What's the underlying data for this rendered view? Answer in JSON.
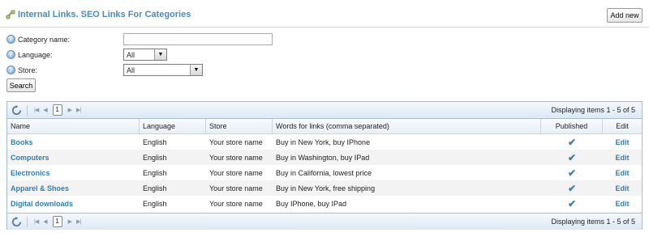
{
  "header": {
    "title": "Internal Links. SEO Links For Categories",
    "add_label": "Add new"
  },
  "filters": {
    "category_label": "Category name:",
    "category_value": "",
    "language_label": "Language:",
    "language_value": "All",
    "store_label": "Store:",
    "store_value": "All",
    "search_label": "Search"
  },
  "pager": {
    "page": "1",
    "info": "Displaying items 1 - 5 of 5"
  },
  "columns": [
    "Name",
    "Language",
    "Store",
    "Words for links (comma separated)",
    "Published",
    "Edit"
  ],
  "rows": [
    {
      "name": "Books",
      "language": "English",
      "store": "Your store name",
      "words": "Buy in New York, buy IPhone",
      "published": true,
      "edit": "Edit"
    },
    {
      "name": "Computers",
      "language": "English",
      "store": "Your store name",
      "words": "Buy in Washington, buy IPad",
      "published": true,
      "edit": "Edit"
    },
    {
      "name": "Electronics",
      "language": "English",
      "store": "Your store name",
      "words": "Buy in California, lowest price",
      "published": true,
      "edit": "Edit"
    },
    {
      "name": "Apparel & Shoes",
      "language": "English",
      "store": "Your store name",
      "words": "Buy in New York, free shipping",
      "published": true,
      "edit": "Edit"
    },
    {
      "name": "Digital downloads",
      "language": "English",
      "store": "Your store name",
      "words": "Buy IPhone, buy IPad",
      "published": true,
      "edit": "Edit"
    }
  ],
  "colors": {
    "link": "#2f7fb6",
    "title": "#4a8bbf",
    "grid_border": "#a3bdd6"
  }
}
